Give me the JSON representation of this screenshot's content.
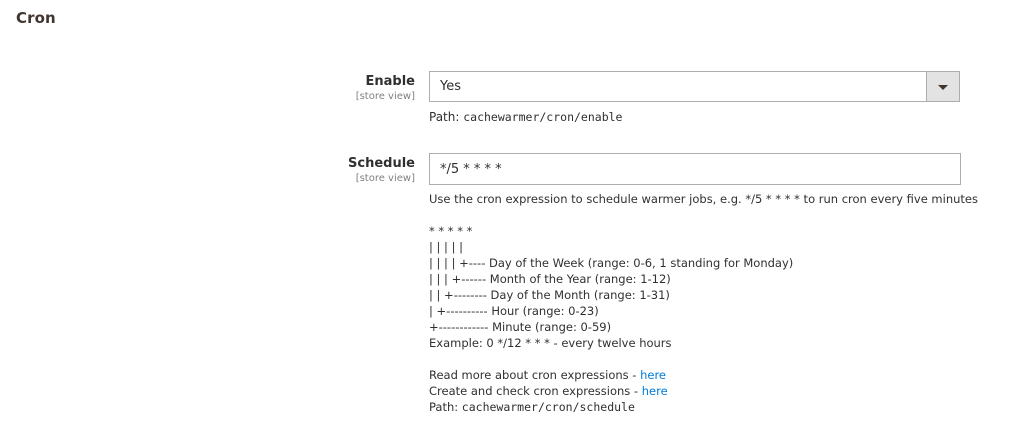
{
  "section": {
    "title": "Cron"
  },
  "enable": {
    "label": "Enable",
    "scope": "[store view]",
    "value": "Yes",
    "path_prefix": "Path: ",
    "path": "cachewarmer/cron/enable"
  },
  "schedule": {
    "label": "Schedule",
    "scope": "[store view]",
    "value": "*/5 * * * *",
    "hint": "Use the cron expression to schedule warmer jobs, e.g. */5 * * * * to run cron every five minutes",
    "diagram": [
      "* * * * *",
      "| | | | |",
      "| | | | +---- Day of the Week (range: 0-6, 1 standing for Monday)",
      "| | | +------ Month of the Year (range: 1-12)",
      "| | +-------- Day of the Month (range: 1-31)",
      "| +---------- Hour (range: 0-23)",
      "+------------ Minute (range: 0-59)",
      "Example: 0 */12 * * * - every twelve hours"
    ],
    "read_more_prefix": "Read more about cron expressions - ",
    "read_more_link": "here",
    "create_check_prefix": "Create and check cron expressions - ",
    "create_check_link": "here",
    "path_prefix": "Path: ",
    "path": "cachewarmer/cron/schedule"
  }
}
